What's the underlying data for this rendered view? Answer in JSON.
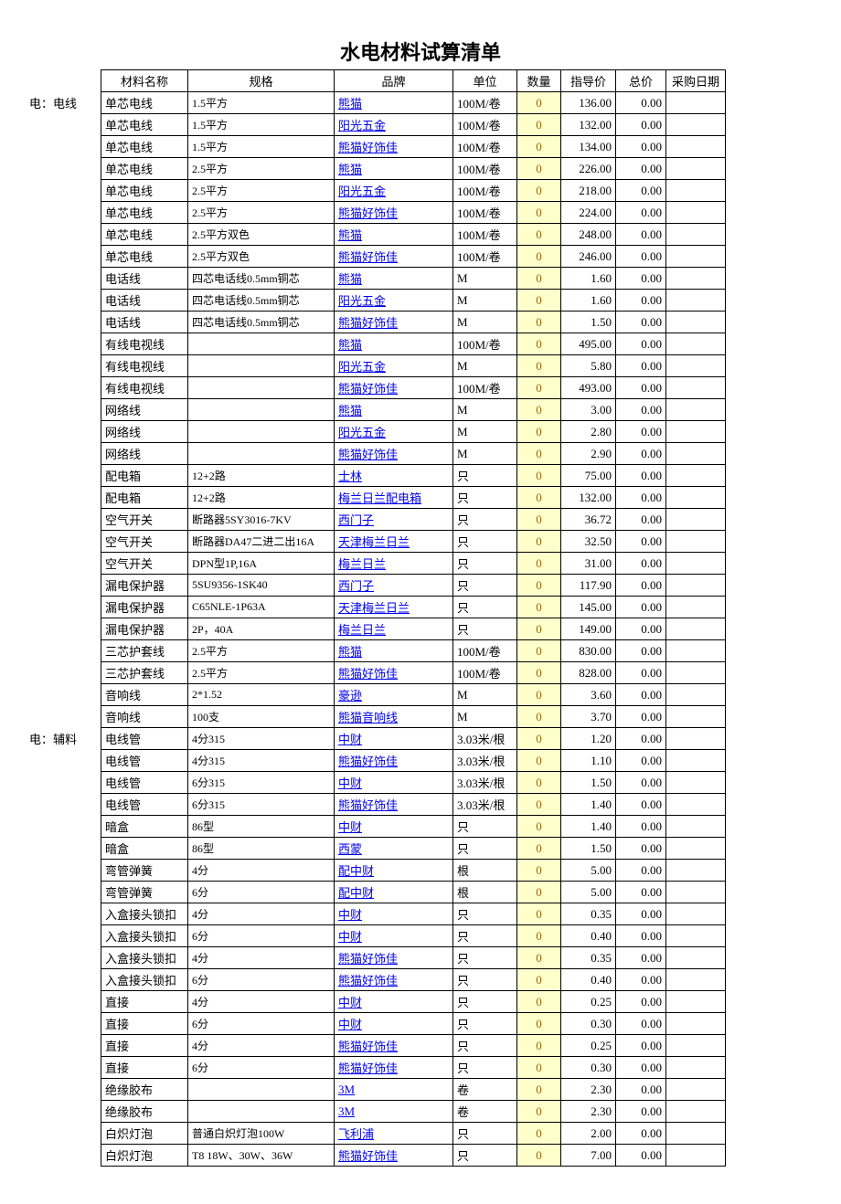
{
  "title": "水电材料试算清单",
  "headers": {
    "name": "材料名称",
    "spec": "规格",
    "brand": "品牌",
    "unit": "单位",
    "qty": "数量",
    "price": "指导价",
    "total": "总价",
    "date": "采购日期"
  },
  "rows": [
    {
      "cat": "电：电线",
      "name": "单芯电线",
      "spec": "1.5平方",
      "brand": "熊猫",
      "unit": "100M/卷",
      "qty": "0",
      "price": "136.00",
      "total": "0.00"
    },
    {
      "cat": "",
      "name": "单芯电线",
      "spec": "1.5平方",
      "brand": "阳光五金",
      "unit": "100M/卷",
      "qty": "0",
      "price": "132.00",
      "total": "0.00"
    },
    {
      "cat": "",
      "name": "单芯电线",
      "spec": "1.5平方",
      "brand": "熊猫好饰佳",
      "unit": "100M/卷",
      "qty": "0",
      "price": "134.00",
      "total": "0.00"
    },
    {
      "cat": "",
      "name": "单芯电线",
      "spec": "2.5平方",
      "brand": "熊猫",
      "unit": "100M/卷",
      "qty": "0",
      "price": "226.00",
      "total": "0.00"
    },
    {
      "cat": "",
      "name": "单芯电线",
      "spec": "2.5平方",
      "brand": "阳光五金",
      "unit": "100M/卷",
      "qty": "0",
      "price": "218.00",
      "total": "0.00"
    },
    {
      "cat": "",
      "name": "单芯电线",
      "spec": "2.5平方",
      "brand": "熊猫好饰佳",
      "unit": "100M/卷",
      "qty": "0",
      "price": "224.00",
      "total": "0.00"
    },
    {
      "cat": "",
      "name": "单芯电线",
      "spec": "2.5平方双色",
      "brand": "熊猫",
      "unit": "100M/卷",
      "qty": "0",
      "price": "248.00",
      "total": "0.00"
    },
    {
      "cat": "",
      "name": "单芯电线",
      "spec": "2.5平方双色",
      "brand": "熊猫好饰佳",
      "unit": "100M/卷",
      "qty": "0",
      "price": "246.00",
      "total": "0.00"
    },
    {
      "cat": "",
      "name": "电话线",
      "spec": "四芯电话线0.5mm铜芯",
      "brand": "熊猫",
      "unit": "M",
      "qty": "0",
      "price": "1.60",
      "total": "0.00"
    },
    {
      "cat": "",
      "name": "电话线",
      "spec": "四芯电话线0.5mm铜芯",
      "brand": "阳光五金",
      "unit": "M",
      "qty": "0",
      "price": "1.60",
      "total": "0.00"
    },
    {
      "cat": "",
      "name": "电话线",
      "spec": "四芯电话线0.5mm铜芯",
      "brand": "熊猫好饰佳",
      "unit": "M",
      "qty": "0",
      "price": "1.50",
      "total": "0.00"
    },
    {
      "cat": "",
      "name": "有线电视线",
      "spec": "",
      "brand": "熊猫",
      "unit": "100M/卷",
      "qty": "0",
      "price": "495.00",
      "total": "0.00"
    },
    {
      "cat": "",
      "name": "有线电视线",
      "spec": "",
      "brand": "阳光五金",
      "unit": "M",
      "qty": "0",
      "price": "5.80",
      "total": "0.00"
    },
    {
      "cat": "",
      "name": "有线电视线",
      "spec": "",
      "brand": "熊猫好饰佳",
      "unit": "100M/卷",
      "qty": "0",
      "price": "493.00",
      "total": "0.00"
    },
    {
      "cat": "",
      "name": "网络线",
      "spec": "",
      "brand": "熊猫",
      "unit": "M",
      "qty": "0",
      "price": "3.00",
      "total": "0.00"
    },
    {
      "cat": "",
      "name": "网络线",
      "spec": "",
      "brand": "阳光五金",
      "unit": "M",
      "qty": "0",
      "price": "2.80",
      "total": "0.00"
    },
    {
      "cat": "",
      "name": "网络线",
      "spec": "",
      "brand": "熊猫好饰佳",
      "unit": "M",
      "qty": "0",
      "price": "2.90",
      "total": "0.00"
    },
    {
      "cat": "",
      "name": "配电箱",
      "spec": "12+2路",
      "brand": "士林",
      "unit": "只",
      "qty": "0",
      "price": "75.00",
      "total": "0.00"
    },
    {
      "cat": "",
      "name": "配电箱",
      "spec": "12+2路",
      "brand": "梅兰日兰配电箱",
      "unit": "只",
      "qty": "0",
      "price": "132.00",
      "total": "0.00"
    },
    {
      "cat": "",
      "name": "空气开关",
      "spec": "断路器5SY3016-7KV",
      "brand": "西门子",
      "unit": "只",
      "qty": "0",
      "price": "36.72",
      "total": "0.00"
    },
    {
      "cat": "",
      "name": "空气开关",
      "spec": "断路器DA47二进二出16A",
      "brand": "天津梅兰日兰",
      "unit": "只",
      "qty": "0",
      "price": "32.50",
      "total": "0.00"
    },
    {
      "cat": "",
      "name": "空气开关",
      "spec": "DPN型1P,16A",
      "brand": "梅兰日兰",
      "unit": "只",
      "qty": "0",
      "price": "31.00",
      "total": "0.00"
    },
    {
      "cat": "",
      "name": "漏电保护器",
      "spec": "5SU9356-1SK40",
      "brand": "西门子",
      "unit": "只",
      "qty": "0",
      "price": "117.90",
      "total": "0.00"
    },
    {
      "cat": "",
      "name": "漏电保护器",
      "spec": "C65NLE-1P63A",
      "brand": "天津梅兰日兰",
      "unit": "只",
      "qty": "0",
      "price": "145.00",
      "total": "0.00"
    },
    {
      "cat": "",
      "name": "漏电保护器",
      "spec": "2P，40A",
      "brand": "梅兰日兰",
      "unit": "只",
      "qty": "0",
      "price": "149.00",
      "total": "0.00"
    },
    {
      "cat": "",
      "name": "三芯护套线",
      "spec": "2.5平方",
      "brand": "熊猫",
      "unit": "100M/卷",
      "qty": "0",
      "price": "830.00",
      "total": "0.00"
    },
    {
      "cat": "",
      "name": "三芯护套线",
      "spec": "2.5平方",
      "brand": "熊猫好饰佳",
      "unit": "100M/卷",
      "qty": "0",
      "price": "828.00",
      "total": "0.00"
    },
    {
      "cat": "",
      "name": "音响线",
      "spec": "2*1.52",
      "brand": "豪逊",
      "unit": "M",
      "qty": "0",
      "price": "3.60",
      "total": "0.00"
    },
    {
      "cat": "",
      "name": "音响线",
      "spec": "100支",
      "brand": "熊猫音响线",
      "unit": "M",
      "qty": "0",
      "price": "3.70",
      "total": "0.00"
    },
    {
      "cat": "电：辅料",
      "name": "电线管",
      "spec": "4分315",
      "brand": "中财",
      "unit": "3.03米/根",
      "qty": "0",
      "price": "1.20",
      "total": "0.00"
    },
    {
      "cat": "",
      "name": "电线管",
      "spec": "4分315",
      "brand": "熊猫好饰佳",
      "unit": "3.03米/根",
      "qty": "0",
      "price": "1.10",
      "total": "0.00"
    },
    {
      "cat": "",
      "name": "电线管",
      "spec": "6分315",
      "brand": "中财",
      "unit": "3.03米/根",
      "qty": "0",
      "price": "1.50",
      "total": "0.00"
    },
    {
      "cat": "",
      "name": "电线管",
      "spec": "6分315",
      "brand": "熊猫好饰佳",
      "unit": "3.03米/根",
      "qty": "0",
      "price": "1.40",
      "total": "0.00"
    },
    {
      "cat": "",
      "name": "暗盒",
      "spec": "86型",
      "brand": "中财",
      "unit": "只",
      "qty": "0",
      "price": "1.40",
      "total": "0.00"
    },
    {
      "cat": "",
      "name": "暗盒",
      "spec": "86型",
      "brand": "西蒙",
      "unit": "只",
      "qty": "0",
      "price": "1.50",
      "total": "0.00"
    },
    {
      "cat": "",
      "name": "弯管弹簧",
      "spec": "4分",
      "brand": "配中财",
      "unit": "根",
      "qty": "0",
      "price": "5.00",
      "total": "0.00"
    },
    {
      "cat": "",
      "name": "弯管弹簧",
      "spec": "6分",
      "brand": "配中财",
      "unit": "根",
      "qty": "0",
      "price": "5.00",
      "total": "0.00"
    },
    {
      "cat": "",
      "name": "入盒接头锁扣",
      "spec": "4分",
      "brand": "中财",
      "unit": "只",
      "qty": "0",
      "price": "0.35",
      "total": "0.00"
    },
    {
      "cat": "",
      "name": "入盒接头锁扣",
      "spec": "6分",
      "brand": "中财",
      "unit": "只",
      "qty": "0",
      "price": "0.40",
      "total": "0.00"
    },
    {
      "cat": "",
      "name": "入盒接头锁扣",
      "spec": "4分",
      "brand": "熊猫好饰佳",
      "unit": "只",
      "qty": "0",
      "price": "0.35",
      "total": "0.00"
    },
    {
      "cat": "",
      "name": "入盒接头锁扣",
      "spec": "6分",
      "brand": "熊猫好饰佳",
      "unit": "只",
      "qty": "0",
      "price": "0.40",
      "total": "0.00"
    },
    {
      "cat": "",
      "name": "直接",
      "spec": "4分",
      "brand": "中财",
      "unit": "只",
      "qty": "0",
      "price": "0.25",
      "total": "0.00"
    },
    {
      "cat": "",
      "name": "直接",
      "spec": "6分",
      "brand": "中财",
      "unit": "只",
      "qty": "0",
      "price": "0.30",
      "total": "0.00"
    },
    {
      "cat": "",
      "name": "直接",
      "spec": "4分",
      "brand": "熊猫好饰佳",
      "unit": "只",
      "qty": "0",
      "price": "0.25",
      "total": "0.00"
    },
    {
      "cat": "",
      "name": "直接",
      "spec": "6分",
      "brand": "熊猫好饰佳",
      "unit": "只",
      "qty": "0",
      "price": "0.30",
      "total": "0.00"
    },
    {
      "cat": "",
      "name": "绝缘胶布",
      "spec": "",
      "brand": "3M",
      "unit": "卷",
      "qty": "0",
      "price": "2.30",
      "total": "0.00"
    },
    {
      "cat": "",
      "name": "绝缘胶布",
      "spec": "",
      "brand": "3M",
      "unit": "卷",
      "qty": "0",
      "price": "2.30",
      "total": "0.00"
    },
    {
      "cat": "",
      "name": "白炽灯泡",
      "spec": "普通白炽灯泡100W",
      "brand": "飞利浦",
      "unit": "只",
      "qty": "0",
      "price": "2.00",
      "total": "0.00"
    },
    {
      "cat": "",
      "name": "白炽灯泡",
      "spec": "T8 18W、30W、36W",
      "brand": "熊猫好饰佳",
      "unit": "只",
      "qty": "0",
      "price": "7.00",
      "total": "0.00"
    }
  ]
}
